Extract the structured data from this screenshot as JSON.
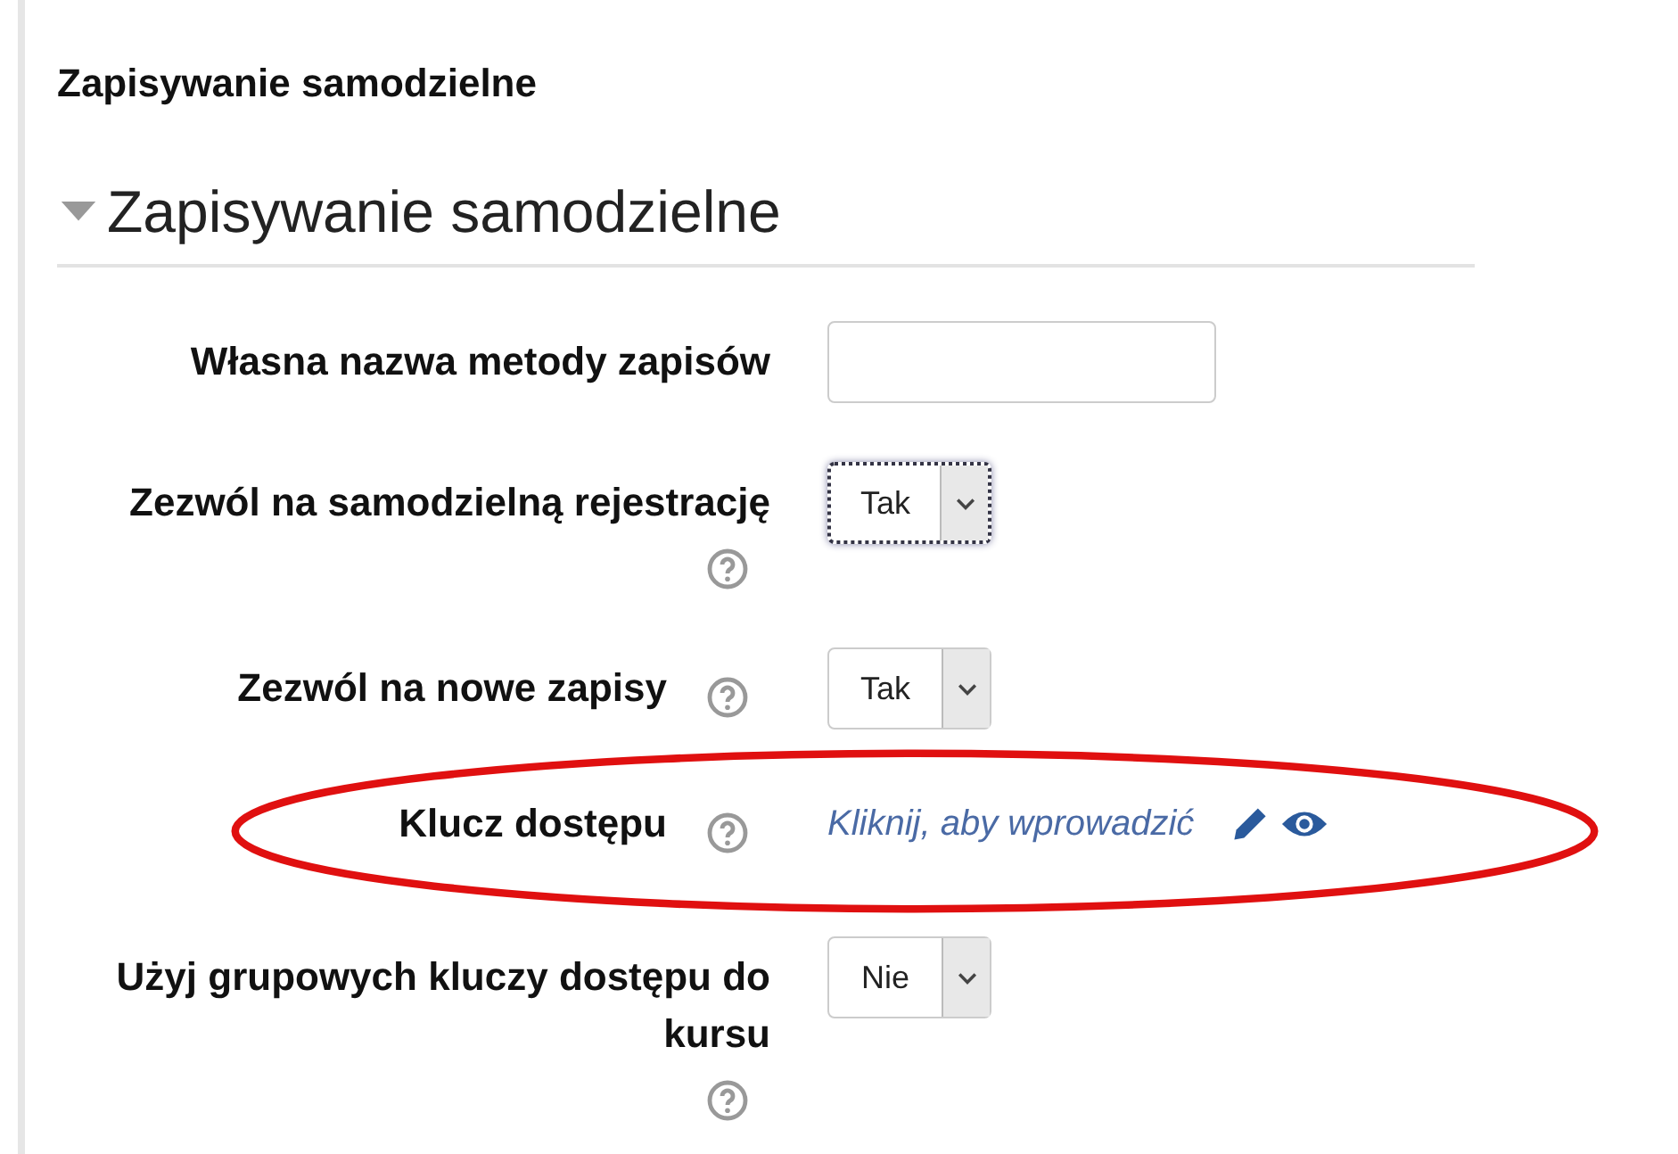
{
  "page_title": "Zapisywanie samodzielne",
  "section": {
    "title": "Zapisywanie samodzielne",
    "expanded": true
  },
  "fields": [
    {
      "kind": "text",
      "label": "Własna nazwa metody zapisów",
      "help": false
    },
    {
      "kind": "select",
      "label": "Zezwól na samodzielną rejestrację",
      "help": true,
      "value": "Tak",
      "focused": true
    },
    {
      "kind": "select",
      "label": "Zezwól na nowe zapisy",
      "help": true,
      "value": "Tak",
      "focused": false
    },
    {
      "kind": "link",
      "label": "Klucz dostępu",
      "help": true,
      "link_text": "Kliknij, aby wprowadzić",
      "highlighted": true
    },
    {
      "kind": "select",
      "label": "Użyj grupowych kluczy dostępu do kursu",
      "help": true,
      "value": "Nie",
      "focused": false
    }
  ]
}
